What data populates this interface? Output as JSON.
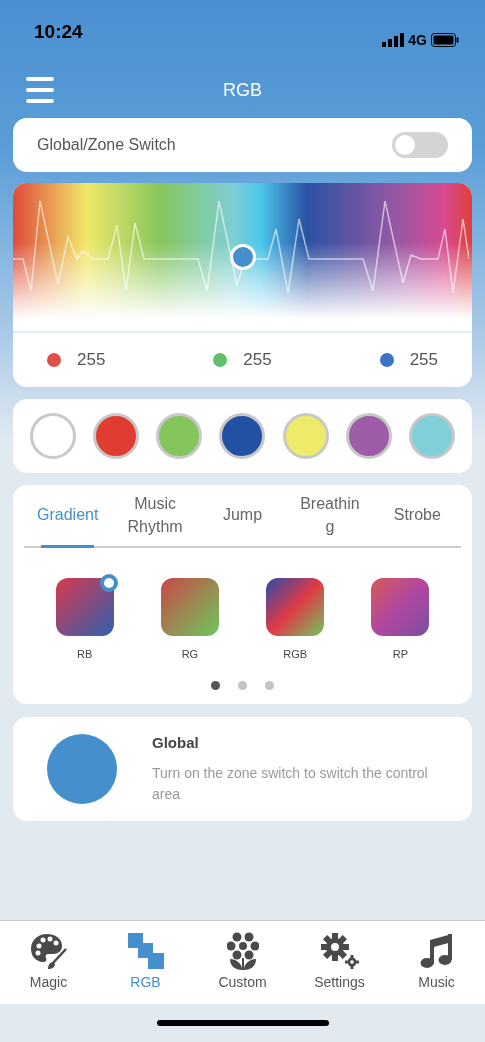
{
  "status_bar": {
    "time": "10:24",
    "network": "4G"
  },
  "header": {
    "title": "RGB"
  },
  "zone_switch": {
    "label": "Global/Zone Switch",
    "on": false
  },
  "color_picker": {
    "level": 0.5
  },
  "channels": [
    {
      "color": "#e0504a",
      "value": "255"
    },
    {
      "color": "#62c06c",
      "value": "255"
    },
    {
      "color": "#3a76c4",
      "value": "255"
    }
  ],
  "swatches": [
    {
      "color": "#ffffff"
    },
    {
      "color": "#e03c32"
    },
    {
      "color": "#84c55c"
    },
    {
      "color": "#2450a4"
    },
    {
      "color": "#eeea6a"
    },
    {
      "color": "#9c5ca6"
    },
    {
      "color": "#80d0da"
    }
  ],
  "mode_tabs": [
    {
      "label": "Gradient",
      "selected": true
    },
    {
      "label": "Music Rhythm",
      "selected": false
    },
    {
      "label": "Jump",
      "selected": false
    },
    {
      "label": "Breathin g",
      "selected": false
    },
    {
      "label": "Strobe",
      "selected": false
    }
  ],
  "patterns": [
    {
      "kind": "rb",
      "label": "RB",
      "selected": true
    },
    {
      "kind": "rg",
      "label": "RG",
      "selected": false
    },
    {
      "kind": "rgb",
      "label": "RGB",
      "selected": false
    },
    {
      "kind": "rp",
      "label": "RP",
      "selected": false
    }
  ],
  "pages": [
    {
      "selected": true
    },
    {
      "selected": false
    },
    {
      "selected": false
    }
  ],
  "zone": {
    "color": "#4590cc",
    "title": "Global",
    "description": "Turn on the zone switch to switch the control area"
  },
  "tab_bar": [
    {
      "kind": "palette",
      "label": "Magic",
      "selected": false
    },
    {
      "kind": "squares",
      "label": "RGB",
      "selected": true
    },
    {
      "kind": "flower",
      "label": "Custom",
      "selected": false
    },
    {
      "kind": "gears",
      "label": "Settings",
      "selected": false
    },
    {
      "kind": "note",
      "label": "Music",
      "selected": false
    }
  ]
}
